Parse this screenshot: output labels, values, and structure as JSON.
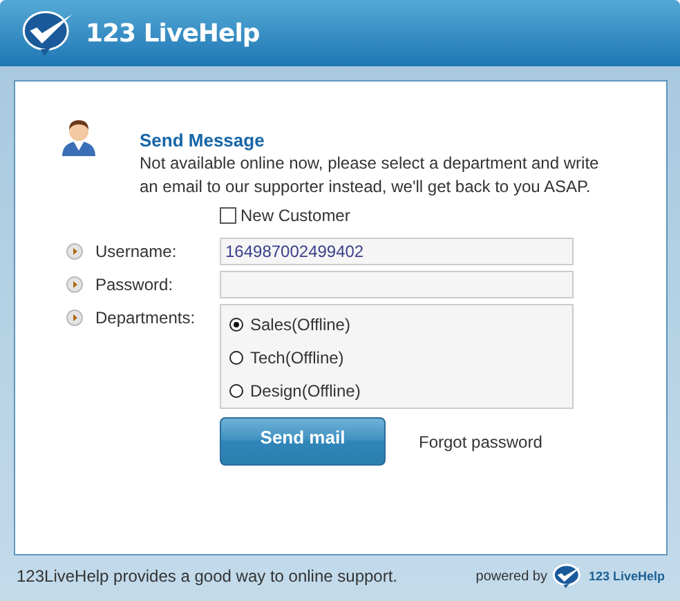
{
  "header": {
    "brand": "123 LiveHelp"
  },
  "message": {
    "title": "Send Message",
    "text": "Not available online now, please select a department and write an email to our supporter instead, we'll get back to you ASAP."
  },
  "new_customer": {
    "label": "New Customer",
    "checked": false
  },
  "fields": [
    {
      "label": "Username:",
      "value": "164987002499402"
    },
    {
      "label": "Password:"
    }
  ],
  "departments": {
    "label": "Departments:",
    "options": [
      {
        "label": "Sales(Offline)",
        "selected": true
      },
      {
        "label": "Tech(Offline)",
        "selected": false
      },
      {
        "label": "Design(Offline)",
        "selected": false
      }
    ]
  },
  "send_button": "Send mail",
  "forgot_link": "Forgot password",
  "status_bar": {
    "text": "123LiveHelp provides a good way to online support.",
    "powered_by": "powered by",
    "brand": "123 LiveHelp"
  }
}
